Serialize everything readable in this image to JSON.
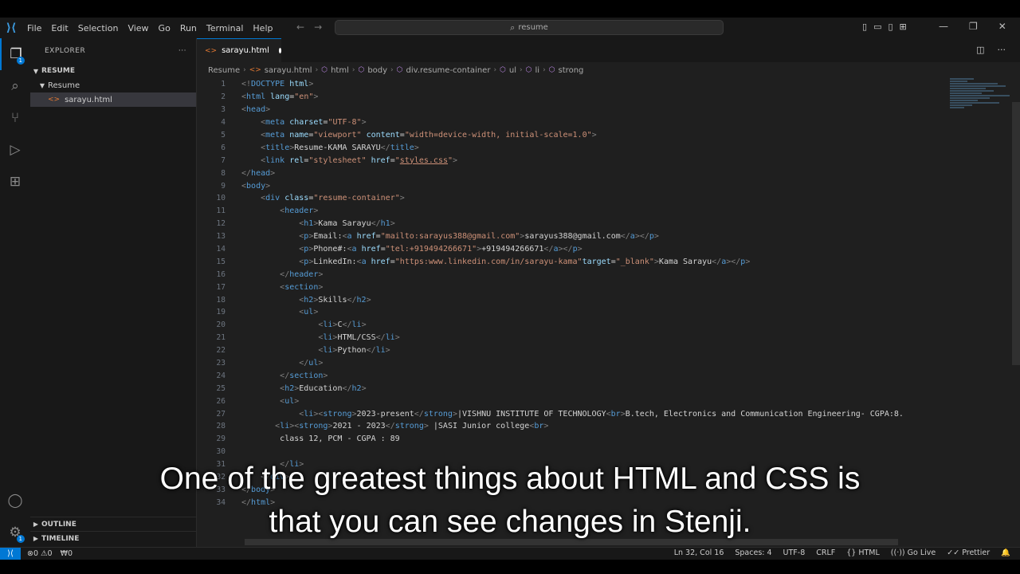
{
  "menu": [
    "File",
    "Edit",
    "Selection",
    "View",
    "Go",
    "Run",
    "Terminal",
    "Help"
  ],
  "command_center": {
    "text": "resume"
  },
  "icons": {
    "explorer": "files-icon",
    "search": "search-icon",
    "scm": "source-control-icon",
    "run": "run-debug-icon",
    "extensions": "extensions-icon",
    "accounts": "account-icon",
    "manage": "gear-icon"
  },
  "activity": {
    "explorer_badge": "1",
    "manage_badge": "1"
  },
  "sidebar": {
    "title": "EXPLORER",
    "more": "···",
    "root": "RESUME",
    "folder": "Resume",
    "file": "sarayu.html",
    "outline": "OUTLINE",
    "timeline": "TIMELINE"
  },
  "tab": {
    "label": "sarayu.html"
  },
  "breadcrumb": [
    "Resume",
    "sarayu.html",
    "html",
    "body",
    "div.resume-container",
    "ul",
    "li",
    "strong"
  ],
  "code_lines": [
    {
      "n": "1",
      "html": "<span class='t'>&lt;!</span><span class='tg'>DOCTYPE</span> <span class='at'>html</span><span class='t'>&gt;</span>"
    },
    {
      "n": "2",
      "html": "<span class='t'>&lt;</span><span class='tg'>html</span> <span class='at'>lang</span>=<span class='st'>\"en\"</span><span class='t'>&gt;</span>"
    },
    {
      "n": "3",
      "html": "<span class='t'>&lt;</span><span class='tg'>head</span><span class='t'>&gt;</span>"
    },
    {
      "n": "4",
      "html": "    <span class='t'>&lt;</span><span class='tg'>meta</span> <span class='at'>charset</span>=<span class='st'>\"UTF-8\"</span><span class='t'>&gt;</span>"
    },
    {
      "n": "5",
      "html": "    <span class='t'>&lt;</span><span class='tg'>meta</span> <span class='at'>name</span>=<span class='st'>\"viewport\"</span> <span class='at'>content</span>=<span class='st'>\"width=device-width, initial-scale=1.0\"</span><span class='t'>&gt;</span>"
    },
    {
      "n": "6",
      "html": "    <span class='t'>&lt;</span><span class='tg'>title</span><span class='t'>&gt;</span><span class='tx'>Resume-KAMA SARAYU</span><span class='t'>&lt;/</span><span class='tg'>title</span><span class='t'>&gt;</span>"
    },
    {
      "n": "7",
      "html": "    <span class='t'>&lt;</span><span class='tg'>link</span> <span class='at'>rel</span>=<span class='st'>\"stylesheet\"</span> <span class='at'>href</span>=<span class='st'>\"</span><span class='link'>styles.css</span><span class='st'>\"</span><span class='t'>&gt;</span>"
    },
    {
      "n": "8",
      "html": "<span class='t'>&lt;/</span><span class='tg'>head</span><span class='t'>&gt;</span>"
    },
    {
      "n": "9",
      "html": "<span class='t'>&lt;</span><span class='tg'>body</span><span class='t'>&gt;</span>"
    },
    {
      "n": "10",
      "html": "    <span class='t'>&lt;</span><span class='tg'>div</span> <span class='at'>class</span>=<span class='st'>\"resume-container\"</span><span class='t'>&gt;</span>"
    },
    {
      "n": "11",
      "html": "        <span class='t'>&lt;</span><span class='tg'>header</span><span class='t'>&gt;</span>"
    },
    {
      "n": "12",
      "html": "            <span class='t'>&lt;</span><span class='tg'>h1</span><span class='t'>&gt;</span><span class='tx'>Kama Sarayu</span><span class='t'>&lt;/</span><span class='tg'>h1</span><span class='t'>&gt;</span>"
    },
    {
      "n": "13",
      "html": "            <span class='t'>&lt;</span><span class='tg'>p</span><span class='t'>&gt;</span><span class='tx'>Email:</span><span class='t'>&lt;</span><span class='tg'>a</span> <span class='at'>href</span>=<span class='st'>\"mailto:sarayus388@gmail.com\"</span><span class='t'>&gt;</span><span class='tx'>sarayus388@gmail.com</span><span class='t'>&lt;/</span><span class='tg'>a</span><span class='t'>&gt;&lt;/</span><span class='tg'>p</span><span class='t'>&gt;</span>"
    },
    {
      "n": "14",
      "html": "            <span class='t'>&lt;</span><span class='tg'>p</span><span class='t'>&gt;</span><span class='tx'>Phone#:</span><span class='t'>&lt;</span><span class='tg'>a</span> <span class='at'>href</span>=<span class='st'>\"tel:+919494266671\"</span><span class='t'>&gt;</span><span class='tx'>+919494266671</span><span class='t'>&lt;/</span><span class='tg'>a</span><span class='t'>&gt;&lt;/</span><span class='tg'>p</span><span class='t'>&gt;</span>"
    },
    {
      "n": "15",
      "html": "            <span class='t'>&lt;</span><span class='tg'>p</span><span class='t'>&gt;</span><span class='tx'>LinkedIn:</span><span class='t'>&lt;</span><span class='tg'>a</span> <span class='at'>href</span>=<span class='st'>\"https:www.linkedin.com/in/sarayu-kama\"</span><span class='at'>target</span>=<span class='st'>\"_blank\"</span><span class='t'>&gt;</span><span class='tx'>Kama Sarayu</span><span class='t'>&lt;/</span><span class='tg'>a</span><span class='t'>&gt;&lt;/</span><span class='tg'>p</span><span class='t'>&gt;</span>"
    },
    {
      "n": "16",
      "html": "        <span class='t'>&lt;/</span><span class='tg'>header</span><span class='t'>&gt;</span>"
    },
    {
      "n": "17",
      "html": "        <span class='t'>&lt;</span><span class='tg'>section</span><span class='t'>&gt;</span>"
    },
    {
      "n": "18",
      "html": "            <span class='t'>&lt;</span><span class='tg'>h2</span><span class='t'>&gt;</span><span class='tx'>Skills</span><span class='t'>&lt;/</span><span class='tg'>h2</span><span class='t'>&gt;</span>"
    },
    {
      "n": "19",
      "html": "            <span class='t'>&lt;</span><span class='tg'>ul</span><span class='t'>&gt;</span>"
    },
    {
      "n": "20",
      "html": "                <span class='t'>&lt;</span><span class='tg'>li</span><span class='t'>&gt;</span><span class='tx'>C</span><span class='t'>&lt;/</span><span class='tg'>li</span><span class='t'>&gt;</span>"
    },
    {
      "n": "21",
      "html": "                <span class='t'>&lt;</span><span class='tg'>li</span><span class='t'>&gt;</span><span class='tx'>HTML/CSS</span><span class='t'>&lt;/</span><span class='tg'>li</span><span class='t'>&gt;</span>"
    },
    {
      "n": "22",
      "html": "                <span class='t'>&lt;</span><span class='tg'>li</span><span class='t'>&gt;</span><span class='tx'>Python</span><span class='t'>&lt;/</span><span class='tg'>li</span><span class='t'>&gt;</span>"
    },
    {
      "n": "23",
      "html": "            <span class='t'>&lt;/</span><span class='tg'>ul</span><span class='t'>&gt;</span>"
    },
    {
      "n": "24",
      "html": "        <span class='t'>&lt;/</span><span class='tg'>section</span><span class='t'>&gt;</span>"
    },
    {
      "n": "25",
      "html": "        <span class='t'>&lt;</span><span class='tg'>h2</span><span class='t'>&gt;</span><span class='tx'>Education</span><span class='t'>&lt;/</span><span class='tg'>h2</span><span class='t'>&gt;</span>"
    },
    {
      "n": "26",
      "html": "        <span class='t'>&lt;</span><span class='tg'>ul</span><span class='t'>&gt;</span>"
    },
    {
      "n": "27",
      "html": "            <span class='t'>&lt;</span><span class='tg'>li</span><span class='t'>&gt;&lt;</span><span class='tg'>strong</span><span class='t'>&gt;</span><span class='tx'>2023-present</span><span class='t'>&lt;/</span><span class='tg'>strong</span><span class='t'>&gt;</span><span class='tx'>|VISHNU INSTITUTE OF TECHNOLOGY</span><span class='t'>&lt;</span><span class='tg'>br</span><span class='t'>&gt;</span><span class='tx'>B.tech, Electronics and Communication Engineering- CGPA:8.</span>"
    },
    {
      "n": "28",
      "html": "       <span class='t'>&lt;</span><span class='tg'>li</span><span class='t'>&gt;&lt;</span><span class='tg'>strong</span><span class='t'>&gt;</span><span class='tx'>2021 - 2023</span><span class='t'>&lt;/</span><span class='tg'>strong</span><span class='t'>&gt;</span><span class='tx'> |SASI Junior college</span><span class='t'>&lt;</span><span class='tg'>br</span><span class='t'>&gt;</span>"
    },
    {
      "n": "29",
      "html": "        <span class='tx'>class 12, PCM - CGPA : 89</span>"
    },
    {
      "n": "30",
      "html": ""
    },
    {
      "n": "31",
      "html": "        <span class='t'>&lt;/</span><span class='tg'>li</span><span class='t'>&gt;</span>"
    },
    {
      "n": "32",
      "html": "    <span class='t'>&lt;/</span><span class='tg'>div</span><span class='t'>&gt;</span>"
    },
    {
      "n": "33",
      "html": "<span class='t'>&lt;/</span><span class='tg'>body</span><span class='t'>&gt;</span>"
    },
    {
      "n": "34",
      "html": "<span class='t'>&lt;/</span><span class='tg'>html</span><span class='t'>&gt;</span>"
    }
  ],
  "status": {
    "remote_icon": "remote-icon",
    "errors": "⊗0 ⚠0",
    "ports": "₩0",
    "position": "Ln 32, Col 16",
    "spaces": "Spaces: 4",
    "encoding": "UTF-8",
    "eol": "CRLF",
    "language": "{} HTML",
    "golive": "((·)) Go Live",
    "prettier": "✓✓ Prettier",
    "bell": "🔔"
  },
  "caption": {
    "line1": "One of the greatest things about HTML and CSS is",
    "line2": "that you can see changes in Stenji."
  }
}
